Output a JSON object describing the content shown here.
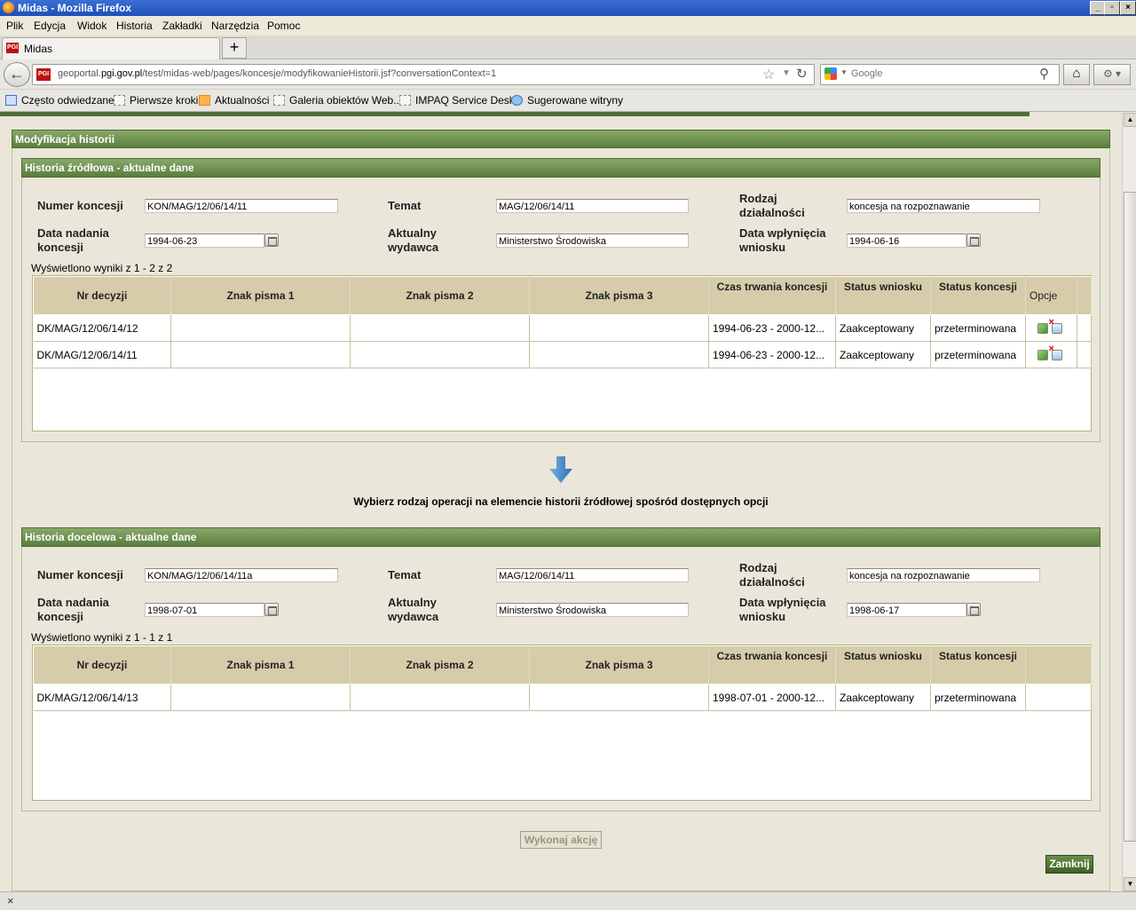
{
  "window": {
    "title": "Midas - Mozilla Firefox",
    "buttons": [
      "_",
      "▫",
      "×"
    ]
  },
  "menu": [
    "Plik",
    "Edycja",
    "Widok",
    "Historia",
    "Zakładki",
    "Narzędzia",
    "Pomoc"
  ],
  "tab": {
    "label": "Midas",
    "favicon_text": "PGI",
    "new_tab": "+"
  },
  "nav": {
    "url_prefix": "geoportal.",
    "url_domain": "pgi.gov.pl",
    "url_rest": "/test/midas-web/pages/koncesje/modyfikowanieHistorii.jsf?conversationContext=1",
    "search_placeholder": "Google"
  },
  "bookmarks": [
    "Często odwiedzane",
    "Pierwsze kroki",
    "Aktualności",
    "Galeria obiektów Web...",
    "IMPAQ Service Desk",
    "Sugerowane witryny"
  ],
  "page": {
    "panel_title": "Modyfikacja historii",
    "source": {
      "title": "Historia źródłowa - aktualne dane",
      "labels": {
        "numer": "Numer koncesji",
        "temat": "Temat",
        "rodzaj_1": "Rodzaj",
        "rodzaj_2": "działalności",
        "data_nadania_1": "Data nadania",
        "data_nadania_2": "koncesji",
        "wydawca_1": "Aktualny",
        "wydawca_2": "wydawca",
        "data_wplyniecia_1": "Data wpłynięcia",
        "data_wplyniecia_2": "wniosku"
      },
      "values": {
        "numer": "KON/MAG/12/06/14/11",
        "temat": "MAG/12/06/14/11",
        "rodzaj": "koncesja na rozpoznawanie",
        "data_nadania": "1994-06-23",
        "wydawca": "Ministerstwo Środowiska",
        "data_wplyniecia": "1994-06-16"
      },
      "results": "Wyświetlono wyniki z 1 - 2 z 2",
      "columns": [
        "Nr decyzji",
        "Znak pisma 1",
        "Znak pisma 2",
        "Znak pisma 3",
        "Czas trwania koncesji",
        "Status wniosku",
        "Status koncesji",
        "Opcje"
      ],
      "rows": [
        [
          "DK/MAG/12/06/14/12",
          "",
          "",
          "",
          "1994-06-23 - 2000-12...",
          "Zaakceptowany",
          "przeterminowana"
        ],
        [
          "DK/MAG/12/06/14/11",
          "",
          "",
          "",
          "1994-06-23 - 2000-12...",
          "Zaakceptowany",
          "przeterminowana"
        ]
      ]
    },
    "instruction": "Wybierz rodzaj operacji na elemencie historii źródłowej spośród dostępnych opcji",
    "target": {
      "title": "Historia docelowa - aktualne dane",
      "values": {
        "numer": "KON/MAG/12/06/14/11a",
        "temat": "MAG/12/06/14/11",
        "rodzaj": "koncesja na rozpoznawanie",
        "data_nadania": "1998-07-01",
        "wydawca": "Ministerstwo Środowiska",
        "data_wplyniecia": "1998-06-17"
      },
      "results": "Wyświetlono wyniki z 1 - 1 z 1",
      "columns": [
        "Nr decyzji",
        "Znak pisma 1",
        "Znak pisma 2",
        "Znak pisma 3",
        "Czas trwania koncesji",
        "Status wniosku",
        "Status koncesji",
        ""
      ],
      "rows": [
        [
          "DK/MAG/12/06/14/13",
          "",
          "",
          "",
          "1998-07-01 - 2000-12...",
          "Zaakceptowany",
          "przeterminowana"
        ]
      ]
    },
    "exec_button": "Wykonaj akcję",
    "close_button": "Zamknij"
  },
  "status": {
    "close_glyph": "×"
  },
  "colors": {
    "header_green": "#5a7d3c",
    "table_header": "#d6ccaa",
    "page_bg": "#eae6d9"
  }
}
